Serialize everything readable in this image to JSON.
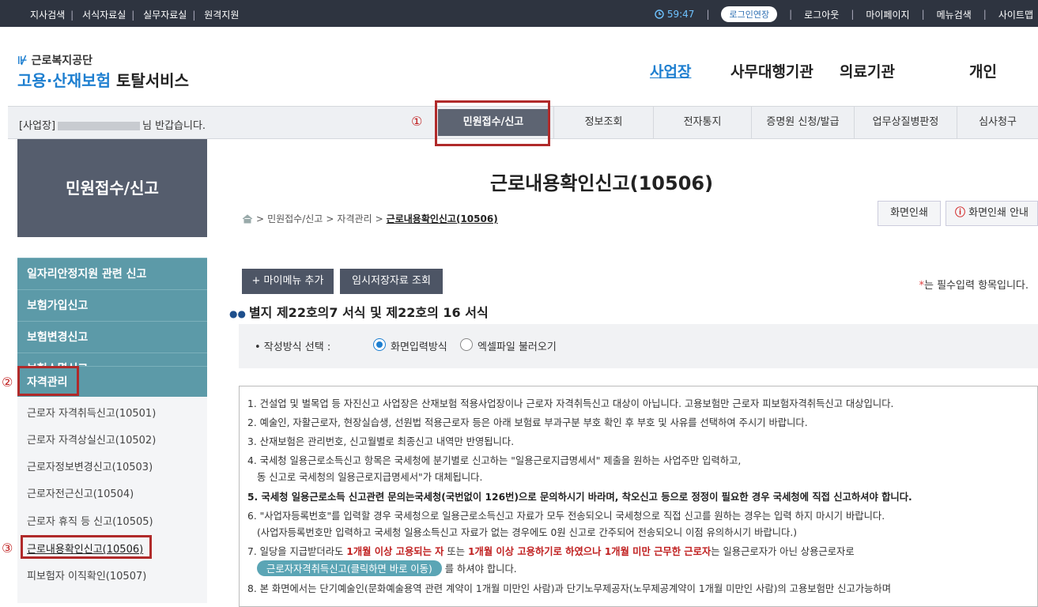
{
  "topbar": {
    "links": [
      "지사검색",
      "서식자료실",
      "실무자료실",
      "원격지원"
    ],
    "timer": "59:47",
    "extend_label": "로그인연장",
    "right_links": [
      "로그아웃",
      "마이페이지",
      "메뉴검색",
      "사이트맵"
    ]
  },
  "brand": {
    "small": "근로복지공단",
    "big1": "고용·산재보험",
    "big2": "토탈서비스"
  },
  "gnav": [
    "사업장",
    "사무대행기관",
    "의료기관",
    "개인"
  ],
  "menubar": {
    "welcome_prefix": "[사업장]",
    "welcome_suffix": "님 반갑습니다.",
    "items": [
      "민원접수/신고",
      "정보조회",
      "전자통지",
      "증명원 신청/발급",
      "업무상질병판정",
      "심사청구"
    ]
  },
  "markers": [
    "①",
    "②",
    "③"
  ],
  "sidebar": {
    "title": "민원접수/신고",
    "groups": [
      "일자리안정지원 관련 신고",
      "보험가입신고",
      "보험변경신고",
      "보험소멸신고",
      "자격관리"
    ],
    "items": [
      "근로자 자격취득신고(10501)",
      "근로자 자격상실신고(10502)",
      "근로자정보변경신고(10503)",
      "근로자전근신고(10504)",
      "근로자 휴직 등 신고(10505)",
      "근로내용확인신고(10506)",
      "피보험자 이직확인(10507)"
    ]
  },
  "main": {
    "title": "근로내용확인신고(10506)",
    "breadcrumb": [
      "민원접수/신고",
      "자격관리",
      "근로내용확인신고(10506)"
    ],
    "print_label": "화면인쇄",
    "print_guide_label": "화면인쇄 안내",
    "mymenu_label": "+ 마이메뉴 추가",
    "temp_label": "임시저장자료 조회",
    "required_star": "*",
    "required_note": "는 필수입력 항목입니다.",
    "section_title": "별지 제22호의7 서식 및 제22호의 16 서식",
    "method_label": "• 작성방식 선택 :",
    "method_options": [
      "화면입력방식",
      "엑셀파일 불러오기"
    ]
  },
  "notice": {
    "l1": "1. 건설업 및 벌목업 등 자진신고 사업장은 산재보험 적용사업장이나 근로자 자격취득신고 대상이 아닙니다. 고용보험만 근로자 피보험자격취득신고 대상입니다.",
    "l2": "2. 예술인, 자활근로자, 현장실습생, 선원법 적용근로자 등은 아래 보험료 부과구분 부호 확인 후 부호 및 사유를 선택하여 주시기 바랍니다.",
    "l3": "3. 산재보험은 관리번호, 신고월별로 최종신고 내역만 반영됩니다.",
    "l4a": "4. 국세청 일용근로소득신고 항목은 국세청에 분기별로 신고하는 \"일용근로지급명세서\" 제출을 원하는 사업주만 입력하고,",
    "l4b": "동 신고로 국세청의 일용근로지급명세서\"가 대체됩니다.",
    "l5": "5. 국세청 일용근로소득 신고관련 문의는국세청(국번없이 126번)으로 문의하시기 바라며, 착오신고 등으로 정정이 필요한 경우 국세청에 직접 신고하셔야 합니다.",
    "l6a": "6. \"사업자등록번호\"를 입력할 경우 국세청으로 일용근로소득신고 자료가 모두 전송되오니 국세청으로 직접 신고를 원하는 경우는 입력 하지 마시기 바랍니다.",
    "l6b": "(사업자등록번호만 입력하고 국세청 일용소득신고 자료가 없는 경우에도 0원 신고로 간주되어 전송되오니 이점 유의하시기 바랍니다.)",
    "l7_a": "7. 일당을 지급받더라도 ",
    "l7_r1": "1개월 이상 고용되는 자",
    "l7_b": " 또는 ",
    "l7_r2": "1개월 이상 고용하기로 하였으나 1개월 미만 근무한 근로자",
    "l7_c": "는 일용근로자가 아닌 상용근로자로",
    "l7_btn": "근로자자격취득신고(클릭하면 바로 이동)",
    "l7_d": "를 하셔야 합니다.",
    "l8": "8. 본 화면에서는 단기예술인(문화예술용역 관련 계약이 1개월 미만인 사람)과 단기노무제공자(노무제공계약이 1개월 미만인 사람)의 고용보험만 신고가능하며"
  }
}
